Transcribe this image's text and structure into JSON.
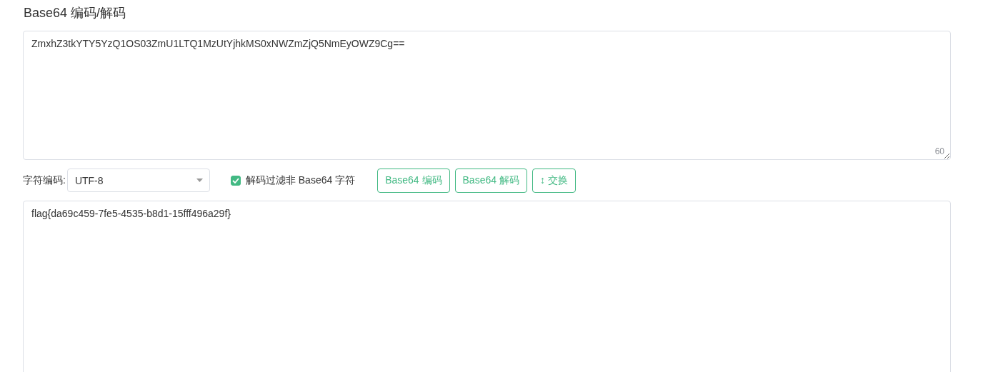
{
  "title": "Base64 编码/解码",
  "input": {
    "value": "ZmxhZ3tkYTY5YzQ1OS03ZmU1LTQ1MzUtYjhkMS0xNWZmZjQ5NmEyOWZ9Cg==",
    "count": "60"
  },
  "charset": {
    "label": "字符编码:",
    "value": "UTF-8"
  },
  "filter": {
    "label": "解码过滤非 Base64 字符",
    "checked": true
  },
  "buttons": [
    {
      "label": "Base64 编码"
    },
    {
      "label": "Base64 解码"
    },
    {
      "label": "↕ 交换"
    }
  ],
  "output": {
    "value": "flag{da69c459-7fe5-4535-b8d1-15fff496a29f}"
  }
}
